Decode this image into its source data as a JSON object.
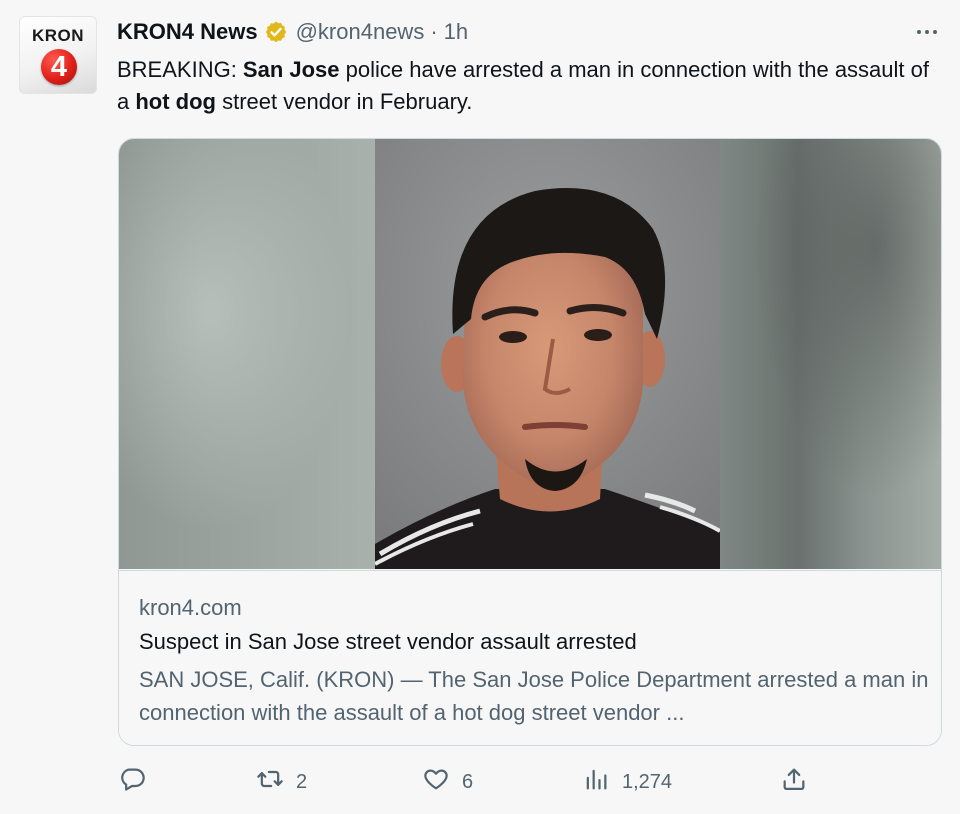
{
  "account": {
    "avatar_text": "KRON",
    "avatar_number": "4",
    "display_name": "KRON4 News",
    "handle": "@kron4news",
    "separator": "·",
    "time": "1h",
    "verified_icon": "verified-gold-badge",
    "verified_color": "#e2b719"
  },
  "tweet": {
    "segments": [
      {
        "text": "BREAKING: ",
        "bold": false
      },
      {
        "text": "San Jose",
        "bold": true
      },
      {
        "text": " police have arrested a man in connection with the assault of a ",
        "bold": false
      },
      {
        "text": "hot dog",
        "bold": true
      },
      {
        "text": " street vendor in February.",
        "bold": false
      }
    ]
  },
  "card": {
    "domain": "kron4.com",
    "title": "Suspect in San Jose street vendor assault arrested",
    "description": "SAN JOSE, Calif. (KRON) — The San Jose Police Department arrested a man in connection with the assault of a hot dog street vendor ..."
  },
  "actions": {
    "reply": {
      "icon": "reply-icon",
      "count": ""
    },
    "retweet": {
      "icon": "retweet-icon",
      "count": "2"
    },
    "like": {
      "icon": "heart-icon",
      "count": "6"
    },
    "views": {
      "icon": "views-bar-icon",
      "count": "1,274"
    },
    "share": {
      "icon": "share-icon",
      "count": ""
    }
  },
  "colors": {
    "text_primary": "#0f1419",
    "text_secondary": "#536471",
    "border": "#cfd9de",
    "background": "#f7f7f7",
    "brand_red": "#e0201a"
  }
}
